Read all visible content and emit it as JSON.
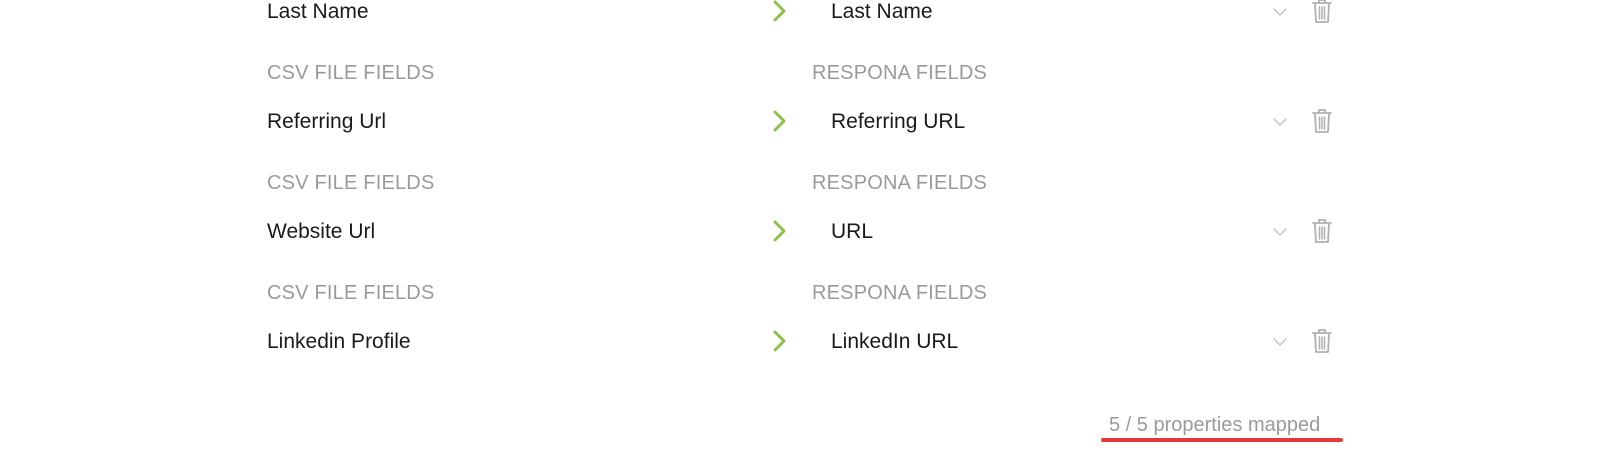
{
  "labels": {
    "csv_fields": "CSV FILE FIELDS",
    "respona_fields": "RESPONA FIELDS"
  },
  "mappings": [
    {
      "csv_field": "Last Name",
      "respona_field": "Last Name"
    },
    {
      "csv_field": "Referring Url",
      "respona_field": "Referring URL"
    },
    {
      "csv_field": "Website Url",
      "respona_field": "URL"
    },
    {
      "csv_field": "Linkedin Profile",
      "respona_field": "LinkedIn URL"
    }
  ],
  "summary": {
    "text": "5 / 5 properties mapped",
    "mapped": 5,
    "total": 5
  },
  "icons": {
    "arrow": "chevron-right-icon",
    "dropdown": "chevron-down-icon",
    "delete": "trash-icon"
  },
  "colors": {
    "accent_green": "#8bc34a",
    "muted_text": "#9a9a9a",
    "icon_gray": "#b0b0b0",
    "underline_red": "#e53935"
  }
}
